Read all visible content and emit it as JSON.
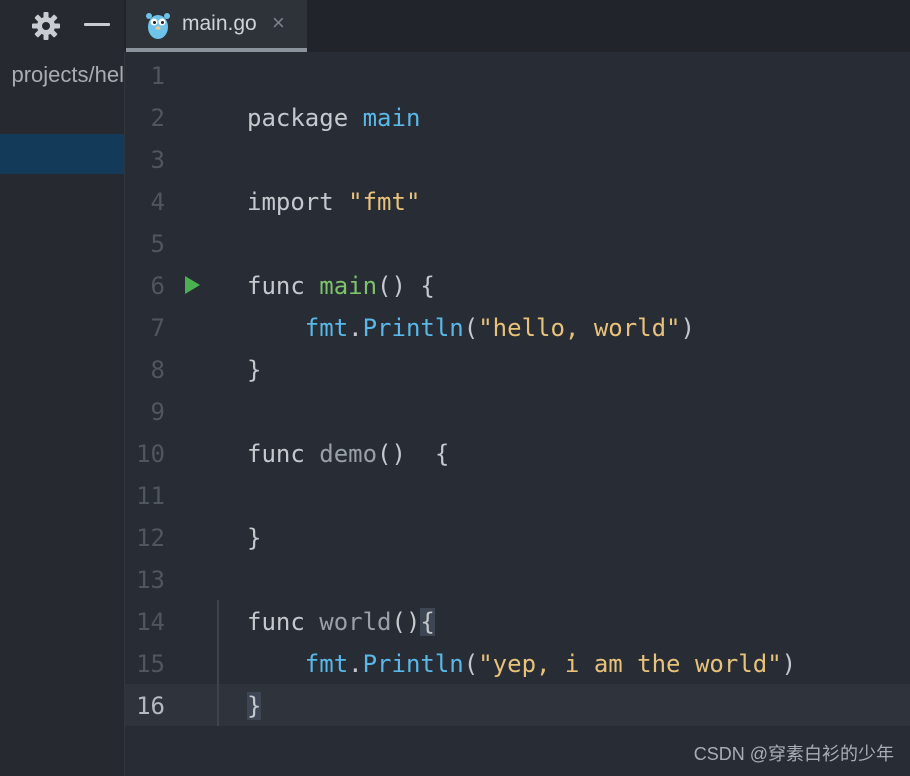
{
  "toolbar": {
    "gear_icon": "gear-icon",
    "minimize_icon": "minimize-icon"
  },
  "tab": {
    "label": "main.go",
    "close": "×",
    "icon": "go-gopher-icon"
  },
  "sidebar": {
    "path": "projects/hel"
  },
  "editor": {
    "current_line": 16,
    "lines": [
      {
        "n": "1",
        "tokens": []
      },
      {
        "n": "2",
        "tokens": [
          {
            "t": "package ",
            "c": "kw"
          },
          {
            "t": "main",
            "c": "pkg"
          }
        ]
      },
      {
        "n": "3",
        "tokens": []
      },
      {
        "n": "4",
        "tokens": [
          {
            "t": "import ",
            "c": "kw"
          },
          {
            "t": "\"fmt\"",
            "c": "str"
          }
        ]
      },
      {
        "n": "5",
        "tokens": []
      },
      {
        "n": "6",
        "run": true,
        "tokens": [
          {
            "t": "func ",
            "c": "kw"
          },
          {
            "t": "main",
            "c": "fn-main"
          },
          {
            "t": "() {",
            "c": "punc"
          }
        ]
      },
      {
        "n": "7",
        "tokens": [
          {
            "t": "    ",
            "c": "punc"
          },
          {
            "t": "fmt",
            "c": "pkg"
          },
          {
            "t": ".",
            "c": "punc"
          },
          {
            "t": "Println",
            "c": "pkg"
          },
          {
            "t": "(",
            "c": "punc"
          },
          {
            "t": "\"hello, world\"",
            "c": "str"
          },
          {
            "t": ")",
            "c": "punc"
          }
        ]
      },
      {
        "n": "8",
        "tokens": [
          {
            "t": "}",
            "c": "punc"
          }
        ]
      },
      {
        "n": "9",
        "tokens": []
      },
      {
        "n": "10",
        "tokens": [
          {
            "t": "func ",
            "c": "kw"
          },
          {
            "t": "demo",
            "c": "fn-other"
          },
          {
            "t": "()  {",
            "c": "punc"
          }
        ]
      },
      {
        "n": "11",
        "tokens": []
      },
      {
        "n": "12",
        "tokens": [
          {
            "t": "}",
            "c": "punc"
          }
        ]
      },
      {
        "n": "13",
        "tokens": []
      },
      {
        "n": "14",
        "tokens": [
          {
            "t": "func ",
            "c": "kw"
          },
          {
            "t": "world",
            "c": "fn-other"
          },
          {
            "t": "()",
            "c": "punc"
          },
          {
            "t": "{",
            "c": "punc brace-hl"
          }
        ]
      },
      {
        "n": "15",
        "tokens": [
          {
            "t": "    ",
            "c": "punc"
          },
          {
            "t": "fmt",
            "c": "pkg"
          },
          {
            "t": ".",
            "c": "punc"
          },
          {
            "t": "Println",
            "c": "pkg"
          },
          {
            "t": "(",
            "c": "punc"
          },
          {
            "t": "\"yep, i am the world\"",
            "c": "str"
          },
          {
            "t": ")",
            "c": "punc"
          }
        ]
      },
      {
        "n": "16",
        "tokens": [
          {
            "t": "}",
            "c": "punc brace-hl"
          }
        ]
      }
    ]
  },
  "colors": {
    "keyword": "#c5c9ce",
    "package": "#59b8e8",
    "func_main": "#7ec36c",
    "string": "#e8c27a",
    "run": "#4caf50"
  },
  "watermark": "CSDN @穿素白衫的少年"
}
